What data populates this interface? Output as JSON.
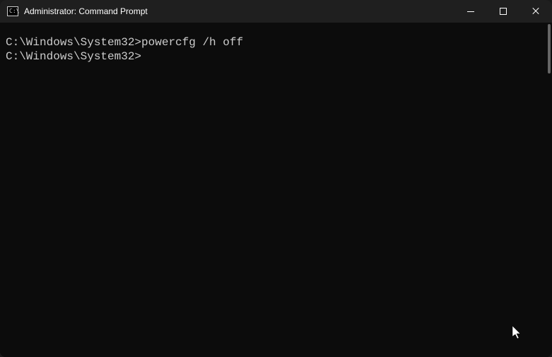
{
  "titlebar": {
    "icon_label": "C:\\",
    "title": "Administrator: Command Prompt"
  },
  "controls": {
    "minimize": "Minimize",
    "maximize": "Maximize",
    "close": "Close"
  },
  "terminal": {
    "line1_prompt": "C:\\Windows\\System32>",
    "line1_command": "powercfg /h off",
    "blank": "",
    "line2_prompt": "C:\\Windows\\System32>"
  }
}
